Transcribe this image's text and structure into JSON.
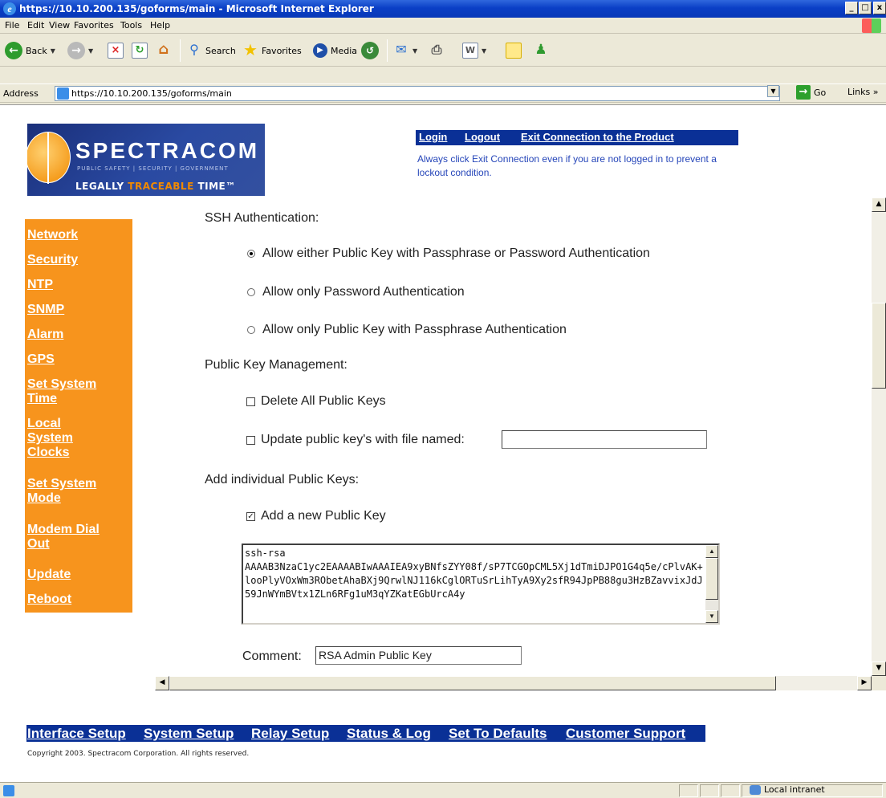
{
  "window": {
    "title": "https://10.10.200.135/goforms/main - Microsoft Internet Explorer",
    "min_label": "_",
    "max_label": "□",
    "close_label": "x"
  },
  "menu": [
    "File",
    "Edit",
    "View",
    "Favorites",
    "Tools",
    "Help"
  ],
  "toolbar": {
    "back_label": "Back",
    "search_label": "Search",
    "favorites_label": "Favorites",
    "media_label": "Media"
  },
  "address": {
    "label": "Address",
    "url": "https://10.10.200.135/goforms/main",
    "go_label": "Go",
    "links_label": "Links"
  },
  "header": {
    "logo_name": "SPECTRACOM",
    "logo_sub": "PUBLIC SAFETY | SECURITY | GOVERNMENT",
    "logo_tag_a": "LEGALLY ",
    "logo_tag_b": "TRACEABLE",
    "logo_tag_c": " TIME™",
    "links": [
      "Login",
      "Logout",
      "Exit Connection to the Product"
    ],
    "lockout_message": "Always click Exit Connection even if you are not logged in to prevent a lockout condition."
  },
  "sidebar": [
    {
      "label": "Network"
    },
    {
      "label": "Security"
    },
    {
      "label": "NTP"
    },
    {
      "label": "SNMP"
    },
    {
      "label": "Alarm"
    },
    {
      "label": "GPS"
    },
    {
      "label": "Set System Time"
    },
    {
      "label": "Local System Clocks"
    },
    {
      "label": "Set System Mode"
    },
    {
      "label": "Modem Dial Out"
    },
    {
      "label": "Update"
    },
    {
      "label": "Reboot"
    }
  ],
  "form": {
    "ssh_auth_heading": "SSH Authentication:",
    "auth_options": [
      {
        "label": "Allow either Public Key with Passphrase or Password Authentication",
        "selected": true
      },
      {
        "label": "Allow only Password Authentication",
        "selected": false
      },
      {
        "label": "Allow only Public Key with Passphrase Authentication",
        "selected": false
      }
    ],
    "key_mgmt_heading": "Public Key Management:",
    "delete_all_label": "Delete All Public Keys",
    "delete_all_checked": false,
    "update_file_label": "Update public key's with file named:",
    "update_file_checked": false,
    "update_file_value": "",
    "add_individual_heading": "Add individual Public Keys:",
    "add_new_label": "Add a new Public Key",
    "add_new_checked": true,
    "public_key_text": "ssh-rsa\nAAAAB3NzaC1yc2EAAAABIwAAAIEA9xyBNfsZYY08f/sP7TCGOpCML5Xj1dTmiDJPO1G4q5e/cPlvAK+looPlyVOxWm3RObetAhaBXj9QrwlNJ116kCglORTuSrLihTyA9Xy2sfR94JpPB88gu3HzBZavvixJdJ59JnWYmBVtx1ZLn6RFg1uM3qYZKatEGbUrcA4y",
    "comment_label": "Comment:",
    "comment_value": "RSA Admin Public Key"
  },
  "footer": {
    "links": [
      "Interface Setup",
      "System Setup",
      "Relay Setup",
      "Status & Log",
      "Set To Defaults",
      "Customer Support"
    ],
    "copyright": "Copyright 2003. Spectracom Corporation. All rights reserved."
  },
  "status_bar": {
    "zone": "Local intranet"
  }
}
